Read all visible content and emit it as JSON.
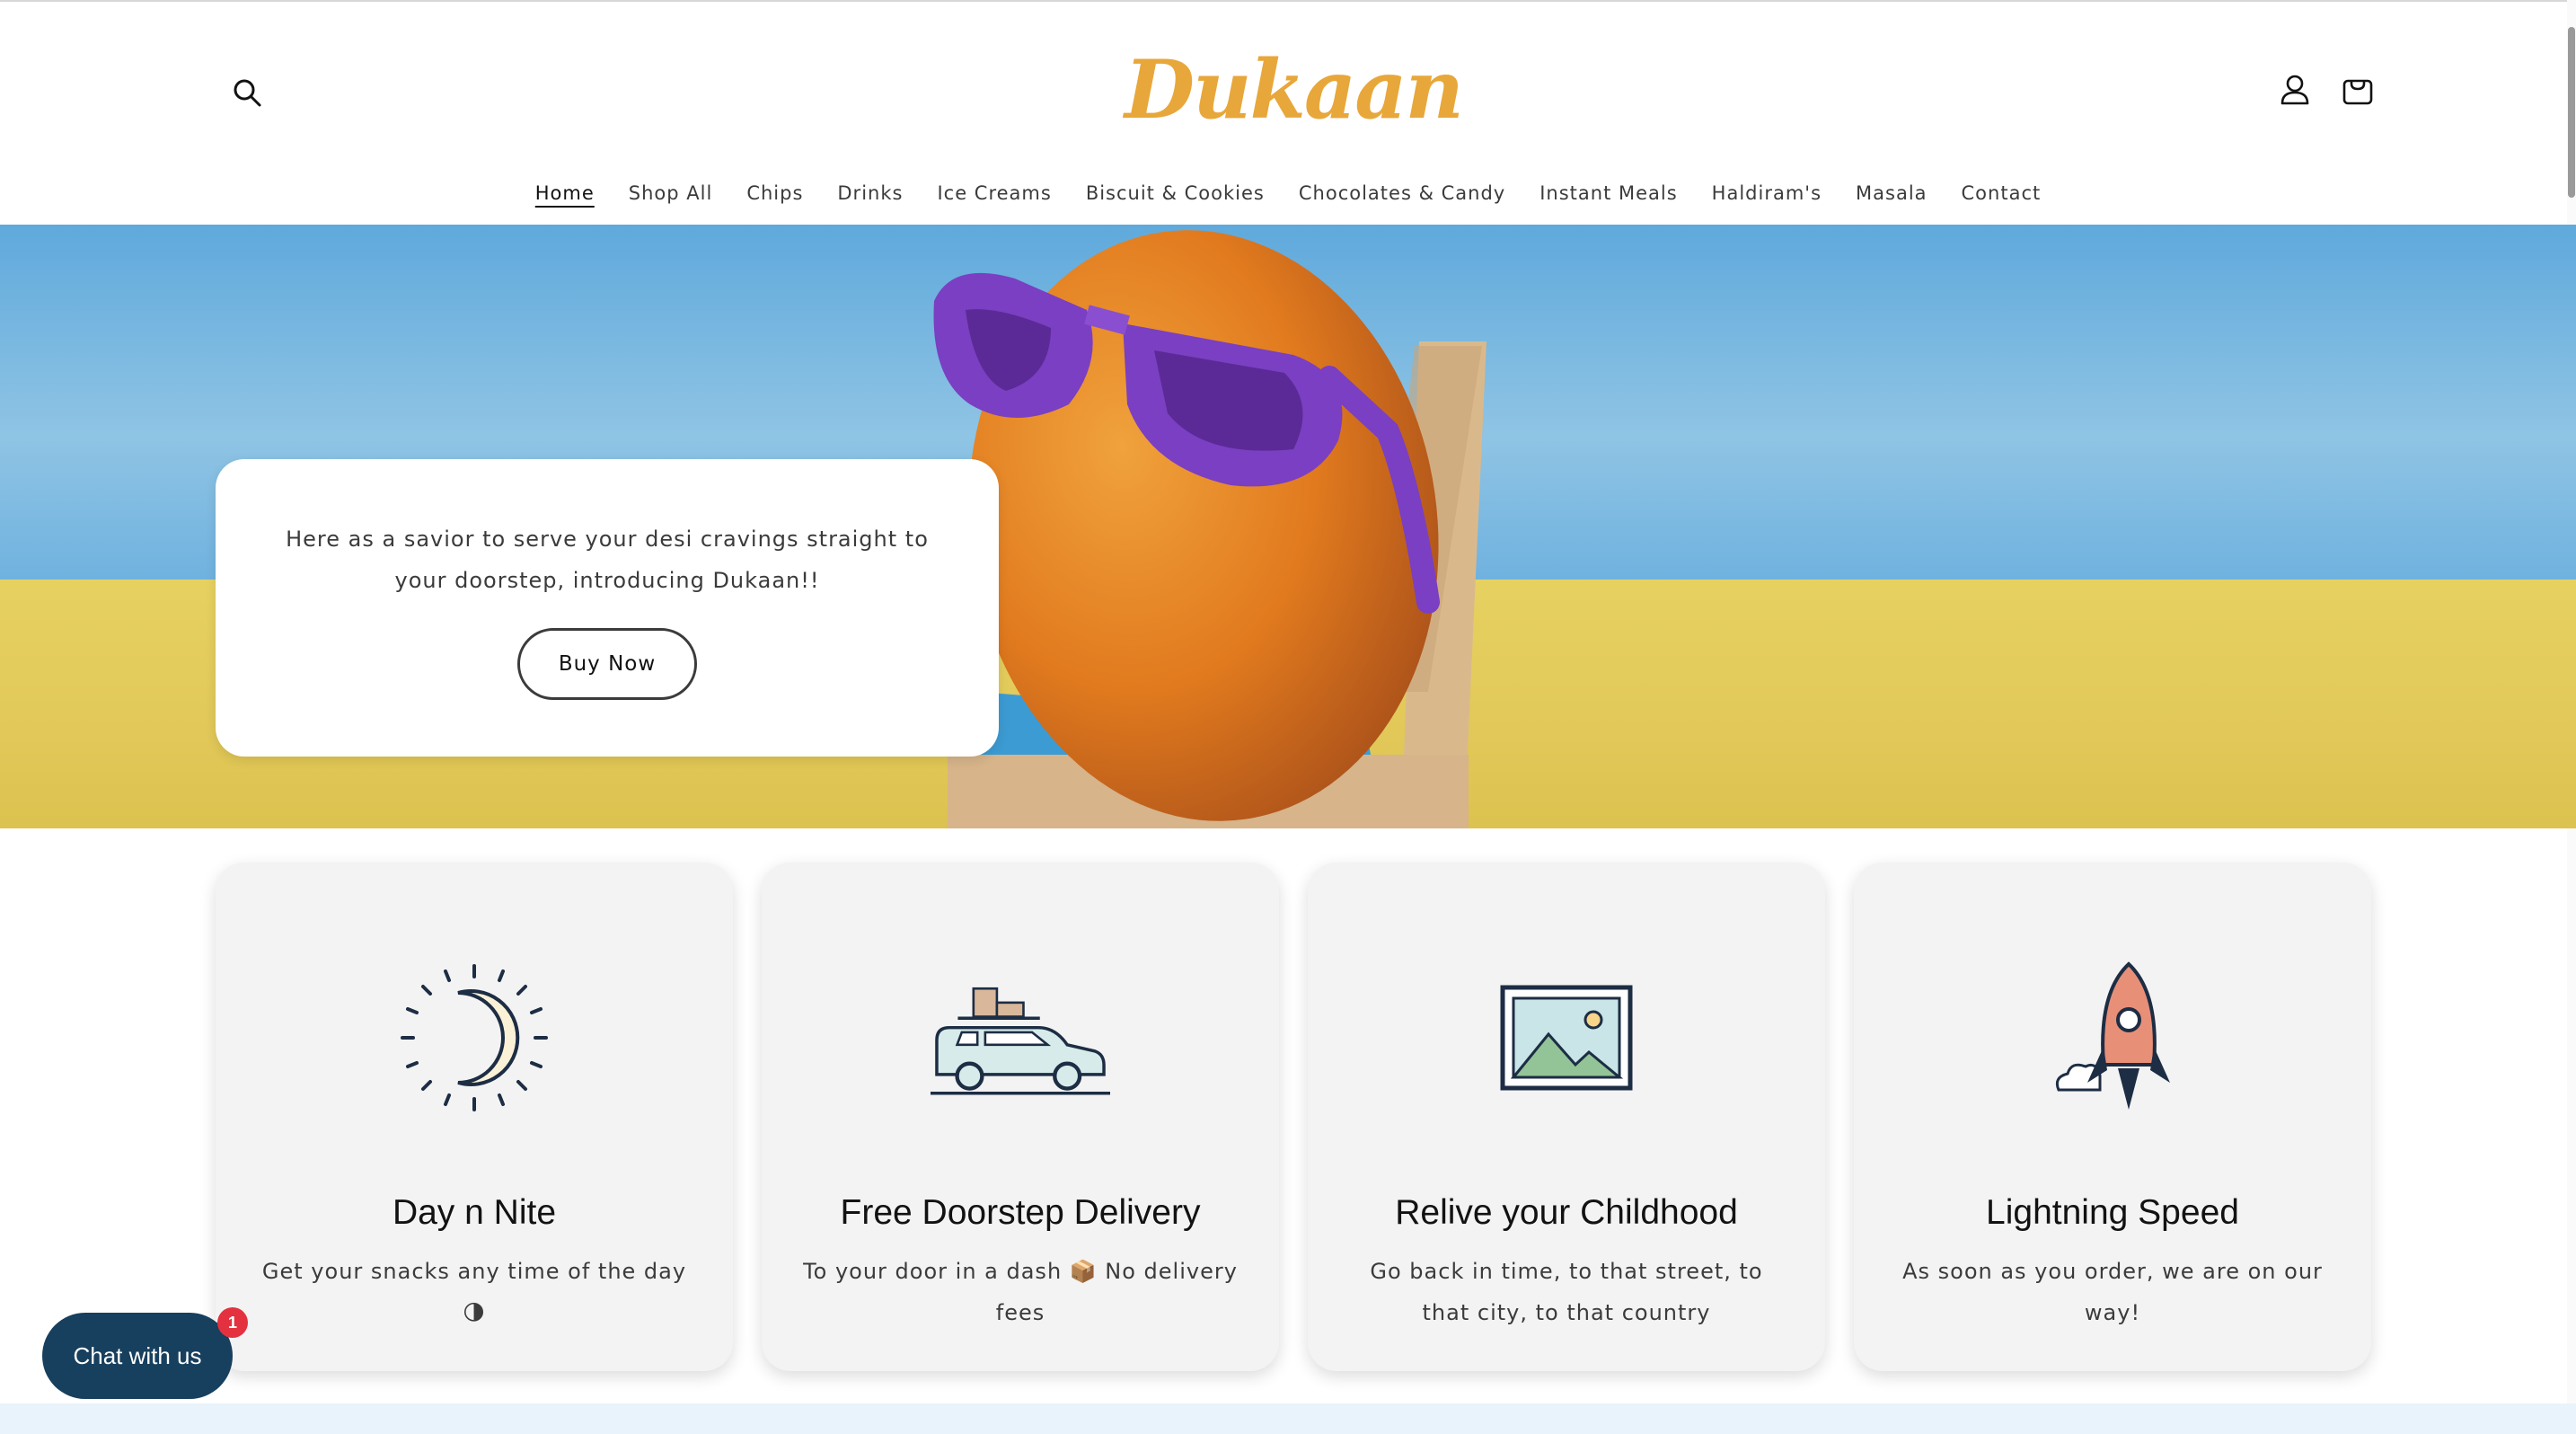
{
  "header": {
    "logo_text": "Dukaan",
    "nav": [
      {
        "label": "Home",
        "active": true
      },
      {
        "label": "Shop All"
      },
      {
        "label": "Chips"
      },
      {
        "label": "Drinks"
      },
      {
        "label": "Ice Creams"
      },
      {
        "label": "Biscuit & Cookies"
      },
      {
        "label": "Chocolates & Candy"
      },
      {
        "label": "Instant Meals"
      },
      {
        "label": "Haldiram's"
      },
      {
        "label": "Masala"
      },
      {
        "label": "Contact"
      }
    ],
    "icons": {
      "search": "search-icon",
      "account": "user-icon",
      "cart": "cart-icon"
    }
  },
  "hero": {
    "text": "Here as a savior to serve your desi cravings straight to your doorstep, introducing Dukaan!!",
    "button_label": "Buy Now",
    "image": "mango-with-sunglasses-on-beach-chair"
  },
  "features": [
    {
      "title": "Day n Nite",
      "text": "Get your snacks any time of the day 🌗",
      "icon": "moon-icon"
    },
    {
      "title": "Free Doorstep Delivery",
      "text": "To your door in a dash 📦 No delivery fees",
      "icon": "car-icon"
    },
    {
      "title": "Relive your Childhood",
      "text": "Go back in time, to that street, to that city, to that country",
      "icon": "picture-icon"
    },
    {
      "title": "Lightning Speed",
      "text": "As soon as you order, we are on our way!",
      "icon": "rocket-icon"
    }
  ],
  "chat": {
    "label": "Chat with us",
    "badge": "1"
  },
  "colors": {
    "logo": "#e8a73a",
    "chat": "#173f5e",
    "badge": "#e4313f",
    "card_bg": "#f3f3f3"
  }
}
